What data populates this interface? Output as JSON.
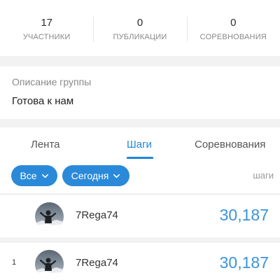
{
  "stats": [
    {
      "value": "17",
      "label": "УЧАСТНИКИ"
    },
    {
      "value": "0",
      "label": "ПУБЛИКАЦИИ"
    },
    {
      "value": "0",
      "label": "СОРЕВНОВАНИЯ"
    }
  ],
  "description": {
    "title": "Описание группы",
    "text": "Готова к нам"
  },
  "tabs": [
    {
      "label": "Лента"
    },
    {
      "label": "Шаги"
    },
    {
      "label": "Соревнования"
    }
  ],
  "active_tab": "Шаги",
  "filters": {
    "all_label": "Все",
    "period_label": "Сегодня",
    "unit_label": "шаги"
  },
  "leaderboard": [
    {
      "rank": "",
      "name": "7Rega74",
      "value": "30,187"
    },
    {
      "rank": "1",
      "name": "7Rega74",
      "value": "30,187"
    }
  ],
  "colors": {
    "accent": "#1f86d8",
    "pill": "#2a8ad9",
    "value": "#3b93db"
  }
}
